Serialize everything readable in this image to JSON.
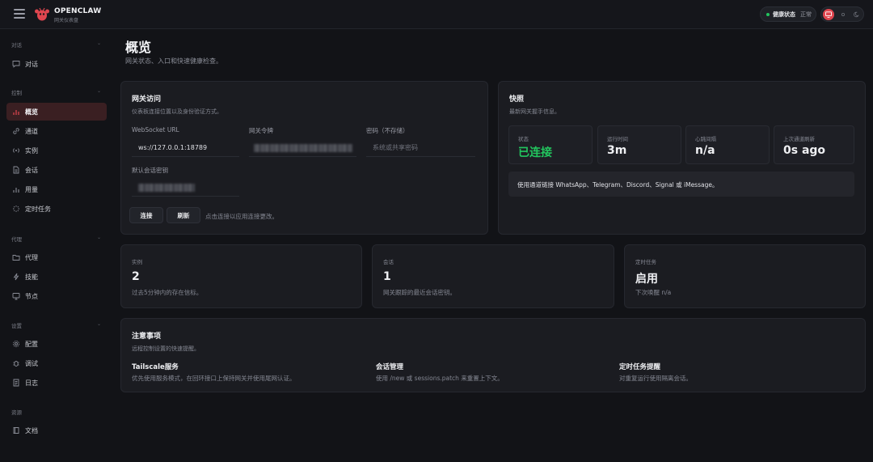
{
  "app": {
    "brand_name": "OPENCLAW",
    "brand_sub": "网关仪表盘",
    "health_label": "健康状态",
    "health_value": "正常",
    "colors": {
      "accent": "#e0464f",
      "ok": "#22c55e",
      "bg": "#121317",
      "card": "#1b1c21"
    }
  },
  "sidebar": {
    "sections": [
      {
        "label": "对话",
        "items": [
          {
            "label": "对话",
            "icon": "message-icon"
          }
        ]
      },
      {
        "label": "控制",
        "items": [
          {
            "label": "概览",
            "icon": "bar-chart-icon",
            "active": true
          },
          {
            "label": "通道",
            "icon": "link-icon"
          },
          {
            "label": "实例",
            "icon": "radio-icon"
          },
          {
            "label": "会话",
            "icon": "file-icon"
          },
          {
            "label": "用量",
            "icon": "bar-chart-icon"
          },
          {
            "label": "定时任务",
            "icon": "loader-icon"
          }
        ]
      },
      {
        "label": "代理",
        "items": [
          {
            "label": "代理",
            "icon": "folder-icon"
          },
          {
            "label": "技能",
            "icon": "zap-icon"
          },
          {
            "label": "节点",
            "icon": "monitor-icon"
          }
        ]
      },
      {
        "label": "设置",
        "items": [
          {
            "label": "配置",
            "icon": "gear-icon"
          },
          {
            "label": "调试",
            "icon": "bug-icon"
          },
          {
            "label": "日志",
            "icon": "log-icon"
          }
        ]
      },
      {
        "label": "资源",
        "items": [
          {
            "label": "文档",
            "icon": "book-icon"
          }
        ]
      }
    ]
  },
  "page": {
    "title": "概览",
    "subtitle": "网关状态、入口和快速健康检查。"
  },
  "gateway": {
    "title": "网关访问",
    "subtitle": "仪表板连接位置以及身份验证方式。",
    "ws_label": "WebSocket URL",
    "ws_value": "ws://127.0.0.1:18789",
    "token_label": "网关令牌",
    "password_label": "密码（不存储）",
    "password_placeholder": "系统或共享密码",
    "session_label": "默认会话密钥",
    "connect_label": "连接",
    "refresh_label": "刷新",
    "hint": "点击连接以应用连接更改。"
  },
  "snapshot": {
    "title": "快照",
    "subtitle": "最新网关握手信息。",
    "stats": [
      {
        "label": "状态",
        "value": "已连接",
        "ok": true
      },
      {
        "label": "运行时间",
        "value": "3m"
      },
      {
        "label": "心跳间隔",
        "value": "n/a"
      },
      {
        "label": "上次通道刷新",
        "value": "0s ago"
      }
    ],
    "notice": "使用通道链接 WhatsApp、Telegram、Discord、Signal 或 iMessage。"
  },
  "metrics": [
    {
      "label": "实例",
      "value": "2",
      "sub": "过去5分钟内的存在信标。"
    },
    {
      "label": "会话",
      "value": "1",
      "sub": "网关跟踪的最近会话密钥。"
    },
    {
      "label": "定时任务",
      "value": "启用",
      "sub": "下次唤醒 n/a"
    }
  ],
  "notes": {
    "title": "注意事项",
    "subtitle": "远程控制设置的快速提醒。",
    "items": [
      {
        "title": "Tailscale服务",
        "text": "优先使用服务模式，在回环接口上保持网关并使用尾网认证。"
      },
      {
        "title": "会话管理",
        "text": "使用 /new 或 sessions.patch 来重置上下文。"
      },
      {
        "title": "定时任务提醒",
        "text": "对重复运行使用隔离会话。"
      }
    ]
  }
}
